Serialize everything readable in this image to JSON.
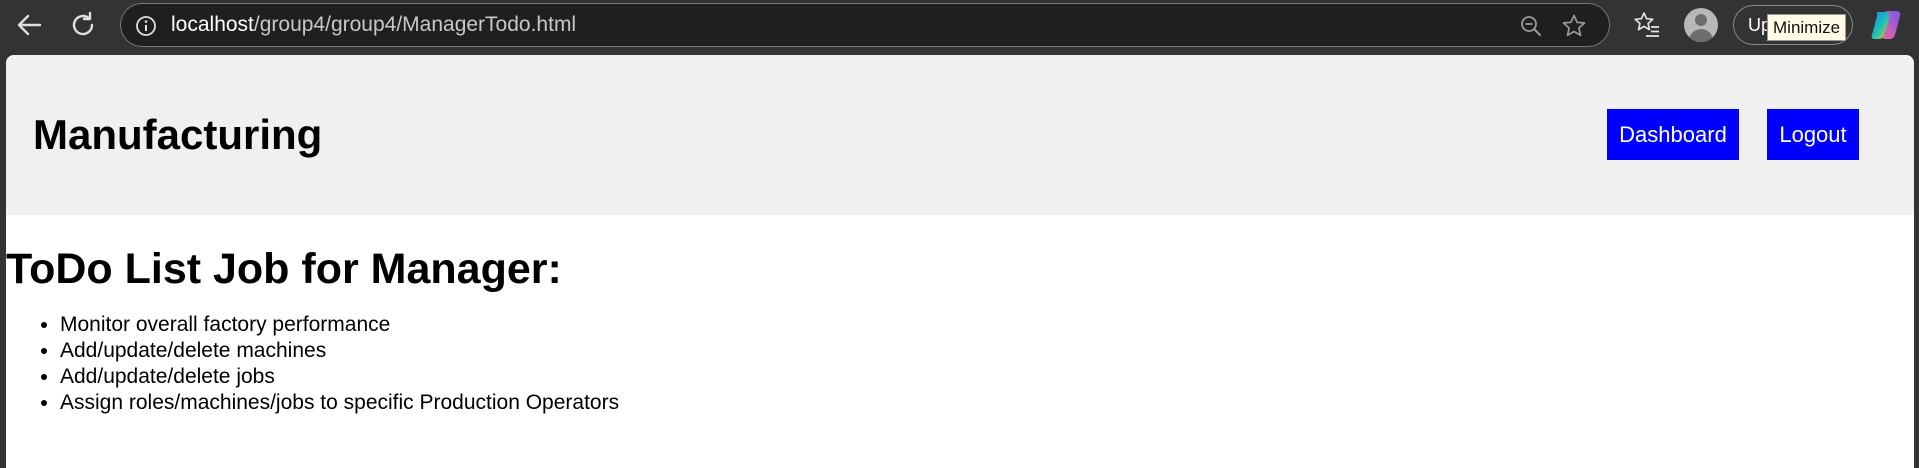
{
  "browser": {
    "url_host": "localhost",
    "url_path": "/group4/group4/ManagerTodo.html",
    "update_label": "Up",
    "tooltip": "Minimize",
    "icons": [
      "back-icon",
      "reload-icon",
      "info-icon",
      "zoom-out-icon",
      "star-icon",
      "favorites-icon",
      "profile-avatar",
      "copilot-icon"
    ]
  },
  "header": {
    "title": "Manufacturing",
    "buttons": {
      "dashboard": "Dashboard",
      "logout": "Logout"
    },
    "button_color": "#0000ff",
    "background_color": "#f0f0f0"
  },
  "main": {
    "heading": "ToDo List Job for Manager:",
    "items": [
      "Monitor overall factory performance",
      "Add/update/delete machines",
      "Add/update/delete jobs",
      "Assign roles/machines/jobs to specific Production Operators"
    ]
  }
}
